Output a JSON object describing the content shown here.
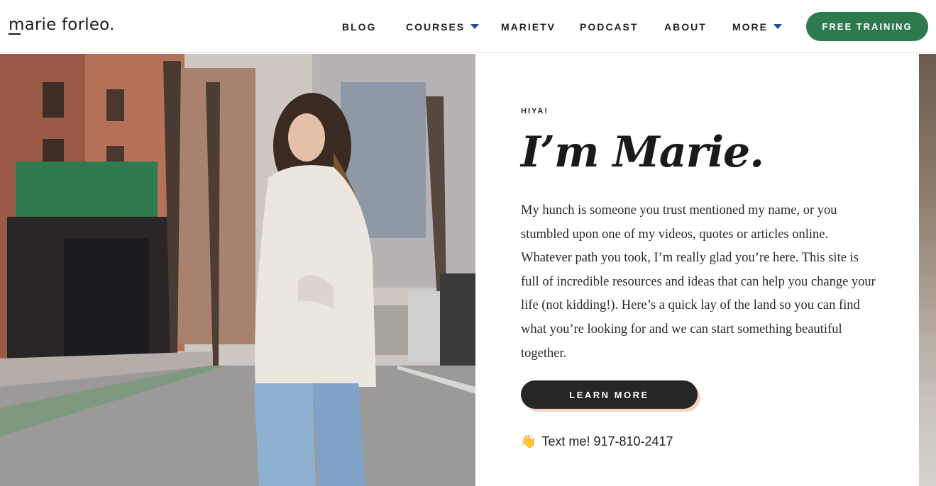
{
  "header": {
    "logo": "marie forleo.",
    "nav": [
      {
        "label": "BLOG",
        "has_dropdown": false
      },
      {
        "label": "COURSES",
        "has_dropdown": true
      },
      {
        "label": "MARIETV",
        "has_dropdown": false
      },
      {
        "label": "PODCAST",
        "has_dropdown": false
      },
      {
        "label": "ABOUT",
        "has_dropdown": false
      },
      {
        "label": "MORE",
        "has_dropdown": true
      }
    ],
    "cta": "FREE TRAINING"
  },
  "hero": {
    "eyebrow": "HIYA!",
    "headline": "I’m Marie.",
    "body": "My hunch is someone you trust mentioned my name, or you stumbled upon one of my videos, quotes or articles online. Whatever path you took, I’m really glad you’re here. This site is full of incredible resources and ideas that can help you change your life (not kidding!). Here’s a quick lay of the land so you can find what you’re looking for and we can start something beautiful together.",
    "button": "LEARN MORE",
    "text_me_icon": "waving-hand-icon",
    "text_me_glyph": "👋",
    "text_me": "Text me! 917-810-2417"
  },
  "colors": {
    "cta_green": "#2d7a4f",
    "caret_blue": "#2b4b92",
    "button_dark": "#262626",
    "button_shadow": "#f1d3c6"
  }
}
